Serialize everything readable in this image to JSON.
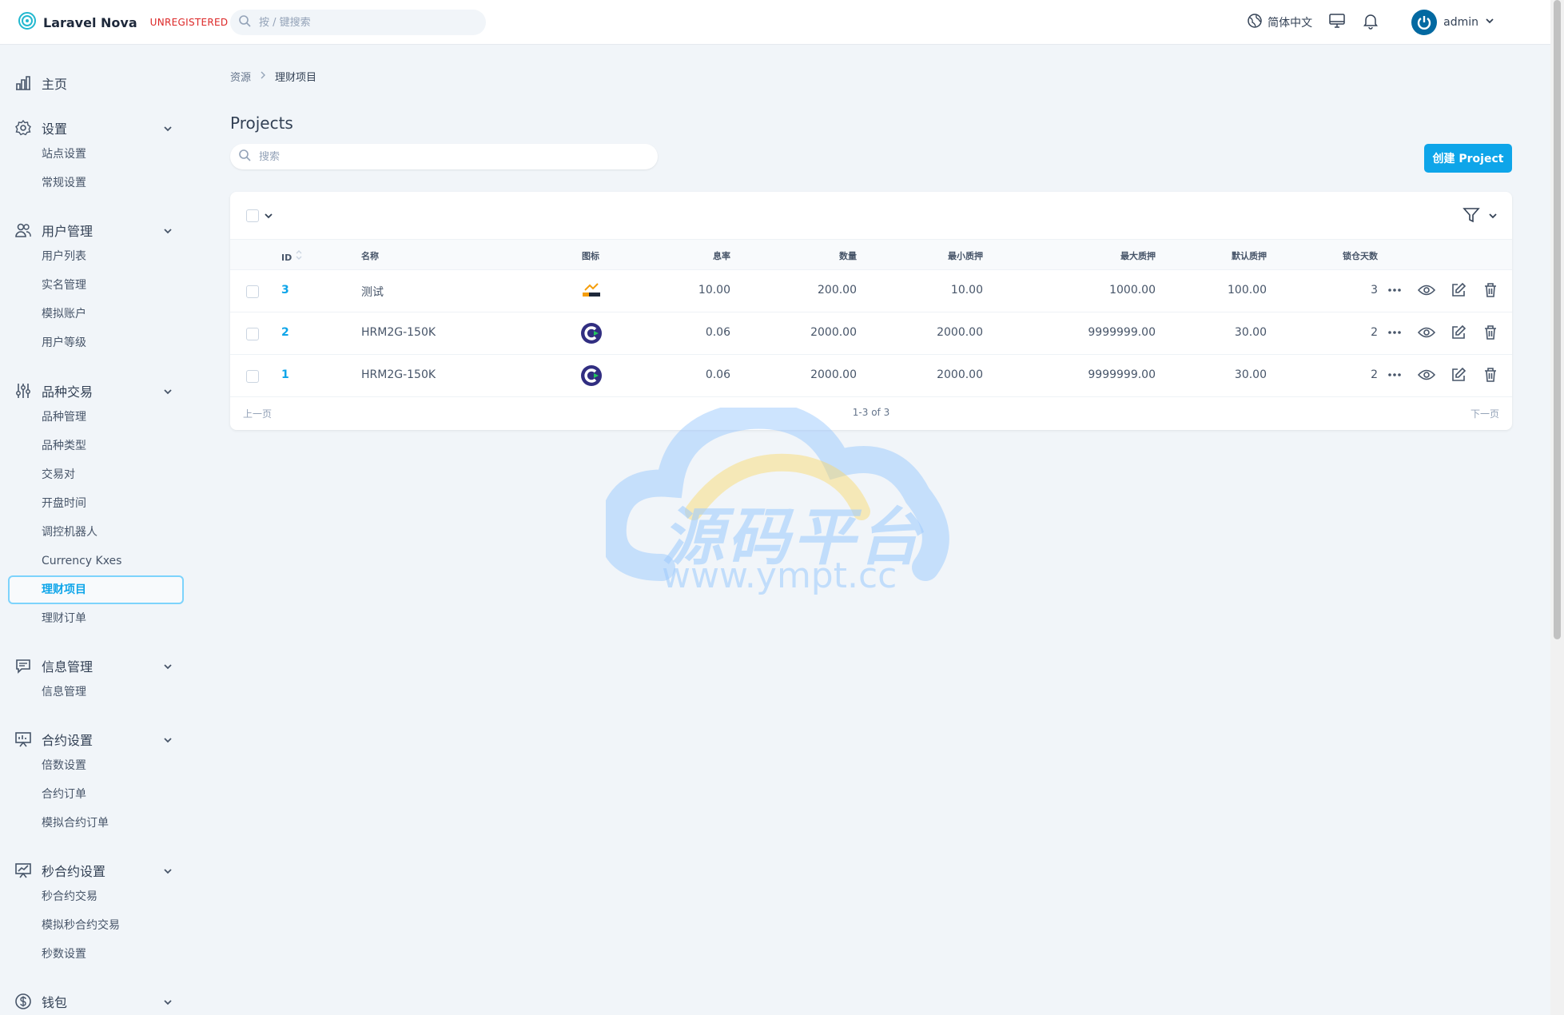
{
  "header": {
    "brand": "Laravel Nova",
    "badge": "UNREGISTERED",
    "search_placeholder": "按 / 键搜索",
    "language": "简体中文",
    "user": "admin"
  },
  "sidebar": {
    "home": "主页",
    "groups": [
      {
        "label": "设置",
        "items": [
          "站点设置",
          "常规设置"
        ]
      },
      {
        "label": "用户管理",
        "items": [
          "用户列表",
          "实名管理",
          "模拟账户",
          "用户等级"
        ]
      },
      {
        "label": "品种交易",
        "items": [
          "品种管理",
          "品种类型",
          "交易对",
          "开盘时间",
          "调控机器人",
          "Currency Kxes",
          "理财项目",
          "理财订单"
        ]
      },
      {
        "label": "信息管理",
        "items": [
          "信息管理"
        ]
      },
      {
        "label": "合约设置",
        "items": [
          "倍数设置",
          "合约订单",
          "模拟合约订单"
        ]
      },
      {
        "label": "秒合约设置",
        "items": [
          "秒合约交易",
          "模拟秒合约交易",
          "秒数设置"
        ]
      },
      {
        "label": "钱包",
        "items": []
      }
    ],
    "active_item": "理财项目"
  },
  "main": {
    "breadcrumb": [
      "资源",
      "理财项目"
    ],
    "title": "Projects",
    "search_placeholder": "搜索",
    "create_label": "创建 Project",
    "columns": [
      "ID",
      "名称",
      "图标",
      "息率",
      "数量",
      "最小质押",
      "最大质押",
      "默认质押",
      "锁仓天数"
    ],
    "rows": [
      {
        "id": "3",
        "name": "测试",
        "icon": "express-logo",
        "rate": "10.00",
        "qty": "200.00",
        "min": "10.00",
        "max": "1000.00",
        "default": "100.00",
        "days": "3"
      },
      {
        "id": "2",
        "name": "HRM2G-150K",
        "icon": "c-logo",
        "rate": "0.06",
        "qty": "2000.00",
        "min": "2000.00",
        "max": "9999999.00",
        "default": "30.00",
        "days": "2"
      },
      {
        "id": "1",
        "name": "HRM2G-150K",
        "icon": "c-logo",
        "rate": "0.06",
        "qty": "2000.00",
        "min": "2000.00",
        "max": "9999999.00",
        "default": "30.00",
        "days": "2"
      }
    ],
    "pager": {
      "prev": "上一页",
      "info": "1-3 of 3",
      "next": "下一页"
    }
  },
  "watermark": {
    "title": "源码平台",
    "url": "www.ympt.cc"
  },
  "colors": {
    "accent": "#0ea5e9",
    "danger": "#dc2626"
  }
}
